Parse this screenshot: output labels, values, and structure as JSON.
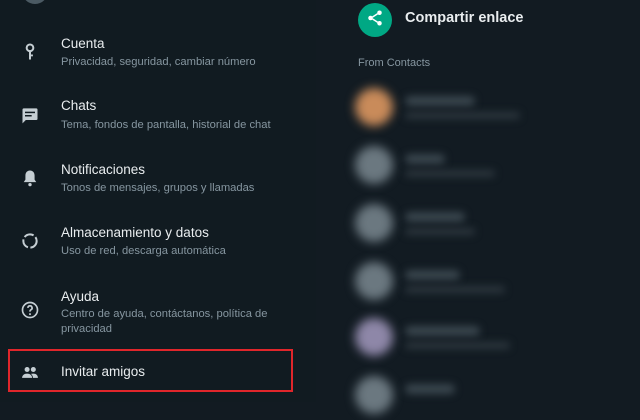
{
  "settings": {
    "items": [
      {
        "title": "Cuenta",
        "subtitle": "Privacidad, seguridad, cambiar número",
        "icon": "key-icon"
      },
      {
        "title": "Chats",
        "subtitle": "Tema, fondos de pantalla, historial de chat",
        "icon": "chat-icon"
      },
      {
        "title": "Notificaciones",
        "subtitle": "Tonos de mensajes, grupos y llamadas",
        "icon": "bell-icon"
      },
      {
        "title": "Almacenamiento y datos",
        "subtitle": "Uso de red, descarga automática",
        "icon": "storage-icon"
      },
      {
        "title": "Ayuda",
        "subtitle": "Centro de ayuda, contáctanos, política de privacidad",
        "icon": "help-icon"
      },
      {
        "title": "Invitar amigos",
        "icon": "people-icon"
      }
    ]
  },
  "share": {
    "label": "Compartir enlace",
    "section_label": "From Contacts",
    "icon": "share-icon"
  },
  "colors": {
    "accent": "#00a884",
    "highlight": "#e0262b"
  }
}
